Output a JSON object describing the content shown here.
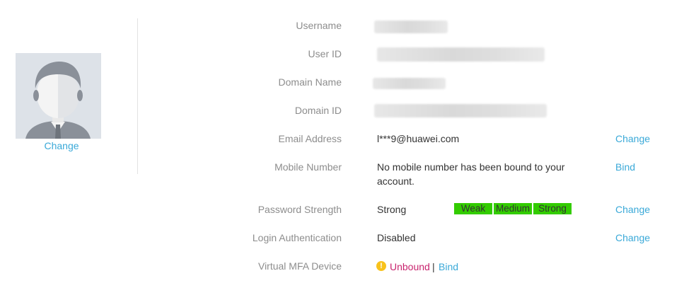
{
  "avatar": {
    "change_label": "Change"
  },
  "fields": {
    "username": {
      "label": "Username"
    },
    "user_id": {
      "label": "User ID"
    },
    "domain_name": {
      "label": "Domain Name"
    },
    "domain_id": {
      "label": "Domain ID"
    },
    "email": {
      "label": "Email Address",
      "value": "l***9@huawei.com",
      "action": "Change"
    },
    "mobile": {
      "label": "Mobile Number",
      "value_line1": "No mobile number has been bound to your",
      "value_line2": "account.",
      "action": "Bind"
    },
    "password": {
      "label": "Password Strength",
      "value": "Strong",
      "action": "Change"
    },
    "login_auth": {
      "label": "Login Authentication",
      "value": "Disabled",
      "action": "Change"
    },
    "mfa": {
      "label": "Virtual MFA Device",
      "status": "Unbound",
      "separator": "|",
      "action": "Bind"
    }
  },
  "strength_meter": {
    "segments": [
      "Weak",
      "Medium",
      "Strong"
    ],
    "level": "Strong",
    "active_color": "#33cc00"
  },
  "colors": {
    "link": "#3aa9d8",
    "label": "#8d8d8d",
    "warning_text": "#c8246e",
    "warning_icon": "#f8c21c"
  },
  "icons": {
    "avatar": "user-silhouette-icon",
    "mfa_status": "warning-circle-icon"
  }
}
